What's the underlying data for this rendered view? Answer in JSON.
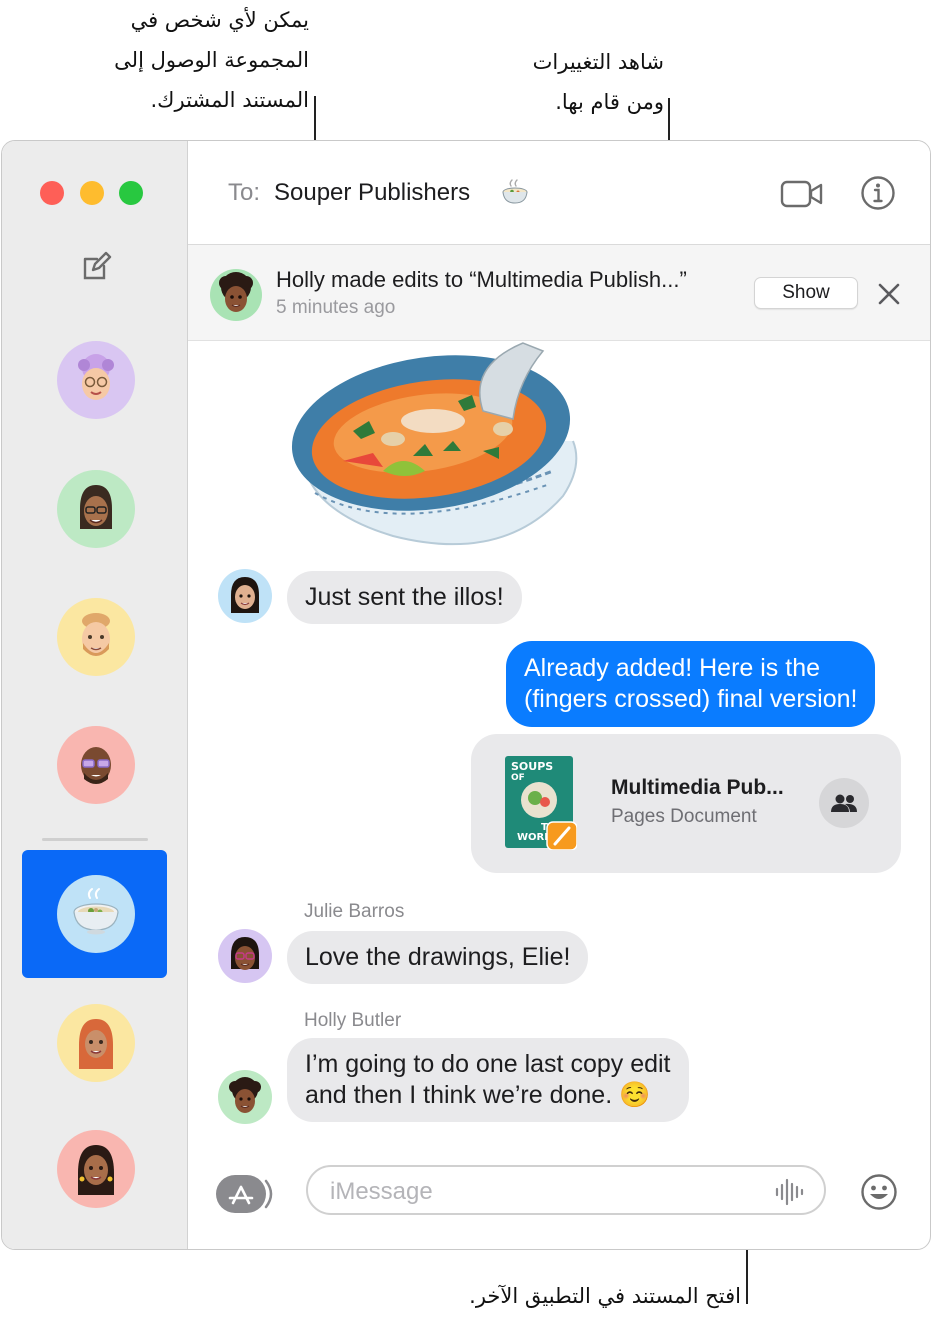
{
  "callouts": {
    "group_access": [
      "يمكن لأي شخص في",
      "المجموعة الوصول إلى",
      "المستند المشترك."
    ],
    "see_changes": [
      "شاهد التغييرات",
      "ومن قام بها."
    ],
    "open_doc": "افتح المستند في التطبيق الآخر."
  },
  "window": {
    "traffic_colors": [
      "#fe5f57",
      "#febc2e",
      "#28c840"
    ]
  },
  "header": {
    "to_label": "To:",
    "recipient": "Souper Publishers",
    "recipient_icon": "soup-bowl-icon",
    "video_icon": "video-camera-icon",
    "info_icon": "info-icon"
  },
  "banner": {
    "title": "Holly made edits to “Multimedia Publish...”",
    "time": "5 minutes ago",
    "show_label": "Show"
  },
  "messages": {
    "m1": "Just sent the illos!",
    "m2_line1": "Already added! Here is the",
    "m2_line2": "(fingers crossed) final version!",
    "doc_title": "Multimedia Pub...",
    "doc_subtitle": "Pages Document",
    "doc_cover": [
      "SOUPS",
      "OF",
      "THE",
      "WORLD"
    ],
    "sender3": "Julie Barros",
    "m3": "Love the drawings, Elie!",
    "sender4": "Holly Butler",
    "m4_line1": "I’m going to do one last copy edit",
    "m4_line2": "and then I think we’re done. ☺️"
  },
  "composer": {
    "placeholder": "iMessage"
  },
  "sidebar": {
    "avatar_bgs": [
      "#d9c6f2",
      "#bde9c4",
      "#fbe7a1",
      "#f9b6b0",
      "#bfe2f7",
      "#fbe7a1",
      "#f9b6b0"
    ],
    "selected_color": "#0a69f7"
  },
  "accent": "#0a7cff"
}
